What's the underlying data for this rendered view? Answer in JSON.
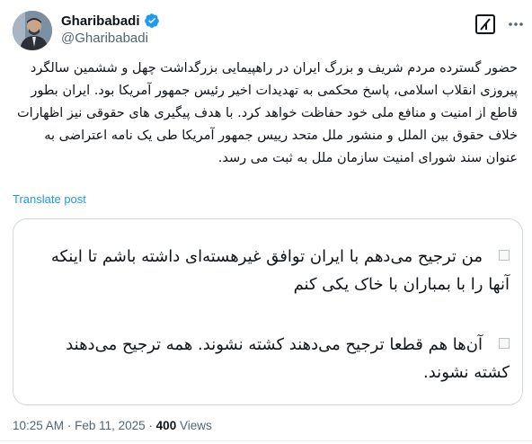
{
  "author": {
    "name": "Gharibabadi",
    "handle": "@Gharibabadi"
  },
  "post": {
    "text": "حضور گسترده مردم شریف و بزرگ ایران در راهپیمایی بزرگداشت چهل و ششمین سالگرد پیروزی انقلاب اسلامی، پاسخ محکمی به تهدیدات اخیر رئیس جمهور آمریکا بود. ایران بطور قاطع از امنیت و منافع ملی خود حفاظت خواهد کرد. با هدف پیگیری های حقوقی نیز اظهارات خلاف حقوق بین الملل و منشور ملل متحد رییس جمهور آمریکا طی یک نامه اعتراضی به عنوان سند شورای امنیت سازمان ملل به ثبت می رسد.",
    "translate_label": "Translate post"
  },
  "quote": {
    "item1": "من ترجیح می‌دهم با ایران توافق غیرهسته‌ای داشته باشم تا اینکه آنها را با بمباران با خاک یکی کنم",
    "item2": "آن‌ها هم قطعا ترجیح می‌دهند کشته نشوند. همه ترجیح می‌دهند کشته نشوند."
  },
  "meta": {
    "time": "10:25 AM",
    "separator": "·",
    "date": "Feb 11, 2025",
    "views_count": "400",
    "views_label": "Views"
  },
  "icons": {
    "verified": "verified-badge-icon",
    "grok": "grok-icon",
    "more": "more-icon"
  },
  "colors": {
    "verified": "#1d9bf0",
    "link": "#1d9bf0",
    "secondary_text": "#536471"
  }
}
